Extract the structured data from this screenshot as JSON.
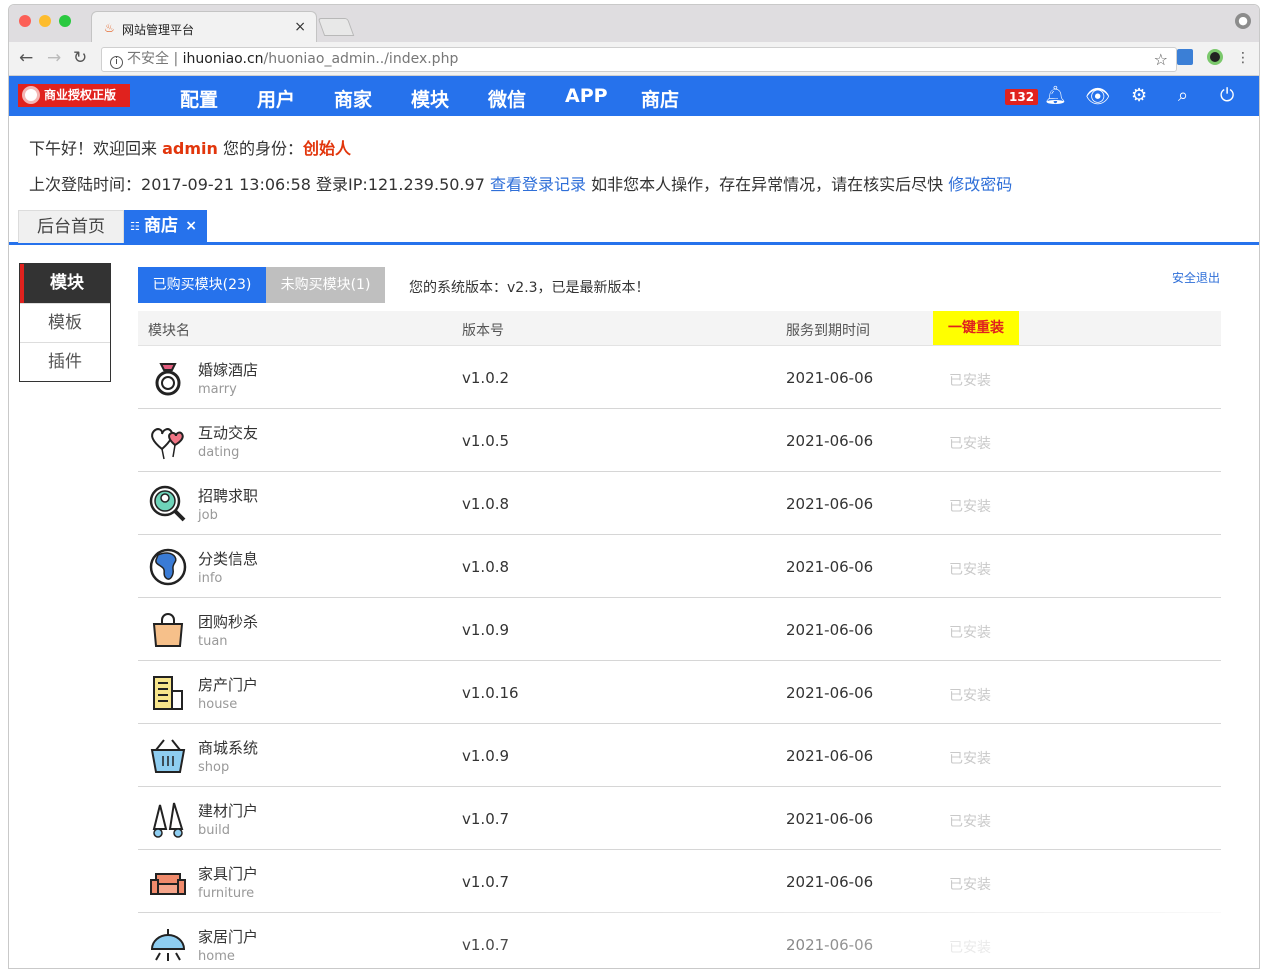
{
  "browser": {
    "tab_title": "网站管理平台",
    "tab_close": "×",
    "url_security": "不安全",
    "url_host": "ihuoniao.cn",
    "url_path": "/huoniao_admin../index.php"
  },
  "header": {
    "license_badge": "商业授权正版",
    "menu": [
      "配置",
      "用户",
      "商家",
      "模块",
      "微信",
      "APP",
      "商店"
    ],
    "notification_count": "132",
    "colors": {
      "bar": "#2672ec",
      "badge": "#e0221e"
    }
  },
  "welcome": {
    "greeting": "下午好！欢迎回来",
    "username": "admin",
    "role_label": "您的身份：",
    "role": "创始人",
    "last_login_label": "上次登陆时间：",
    "last_login_time": "2017-09-21 13:06:58",
    "login_ip_label": "登录IP:",
    "login_ip": "121.239.50.97",
    "view_log_link": "查看登录记录",
    "warning": "如非您本人操作，存在异常情况，请在核实后尽快",
    "change_password_link": "修改密码"
  },
  "page_tabs": {
    "home": "后台首页",
    "active": "商店",
    "close": "×"
  },
  "sidebar": {
    "items": [
      "模块",
      "模板",
      "插件"
    ]
  },
  "store": {
    "purchased_btn": "已购买模块(23)",
    "unpurchased_btn": "未购买模块(1)",
    "version_text": "您的系统版本：v2.3，已是最新版本！",
    "logout": "安全退出",
    "columns": {
      "name": "模块名",
      "version": "版本号",
      "expire": "服务到期时间",
      "reinstall": "一键重装"
    },
    "modules": [
      {
        "name": "婚嫁酒店",
        "code": "marry",
        "version": "v1.0.2",
        "expire": "2021-06-06",
        "status": "已安装",
        "icon": "ring-icon"
      },
      {
        "name": "互动交友",
        "code": "dating",
        "version": "v1.0.5",
        "expire": "2021-06-06",
        "status": "已安装",
        "icon": "balloon-hearts-icon"
      },
      {
        "name": "招聘求职",
        "code": "job",
        "version": "v1.0.8",
        "expire": "2021-06-06",
        "status": "已安装",
        "icon": "magnifier-person-icon"
      },
      {
        "name": "分类信息",
        "code": "info",
        "version": "v1.0.8",
        "expire": "2021-06-06",
        "status": "已安装",
        "icon": "globe-icon"
      },
      {
        "name": "团购秒杀",
        "code": "tuan",
        "version": "v1.0.9",
        "expire": "2021-06-06",
        "status": "已安装",
        "icon": "shopping-bag-icon"
      },
      {
        "name": "房产门户",
        "code": "house",
        "version": "v1.0.16",
        "expire": "2021-06-06",
        "status": "已安装",
        "icon": "building-icon"
      },
      {
        "name": "商城系统",
        "code": "shop",
        "version": "v1.0.9",
        "expire": "2021-06-06",
        "status": "已安装",
        "icon": "basket-icon"
      },
      {
        "name": "建材门户",
        "code": "build",
        "version": "v1.0.7",
        "expire": "2021-06-06",
        "status": "已安装",
        "icon": "tools-icon"
      },
      {
        "name": "家具门户",
        "code": "furniture",
        "version": "v1.0.7",
        "expire": "2021-06-06",
        "status": "已安装",
        "icon": "sofa-icon"
      },
      {
        "name": "家居门户",
        "code": "home",
        "version": "v1.0.7",
        "expire": "2021-06-06",
        "status": "已安装",
        "icon": "lamp-icon"
      }
    ]
  }
}
